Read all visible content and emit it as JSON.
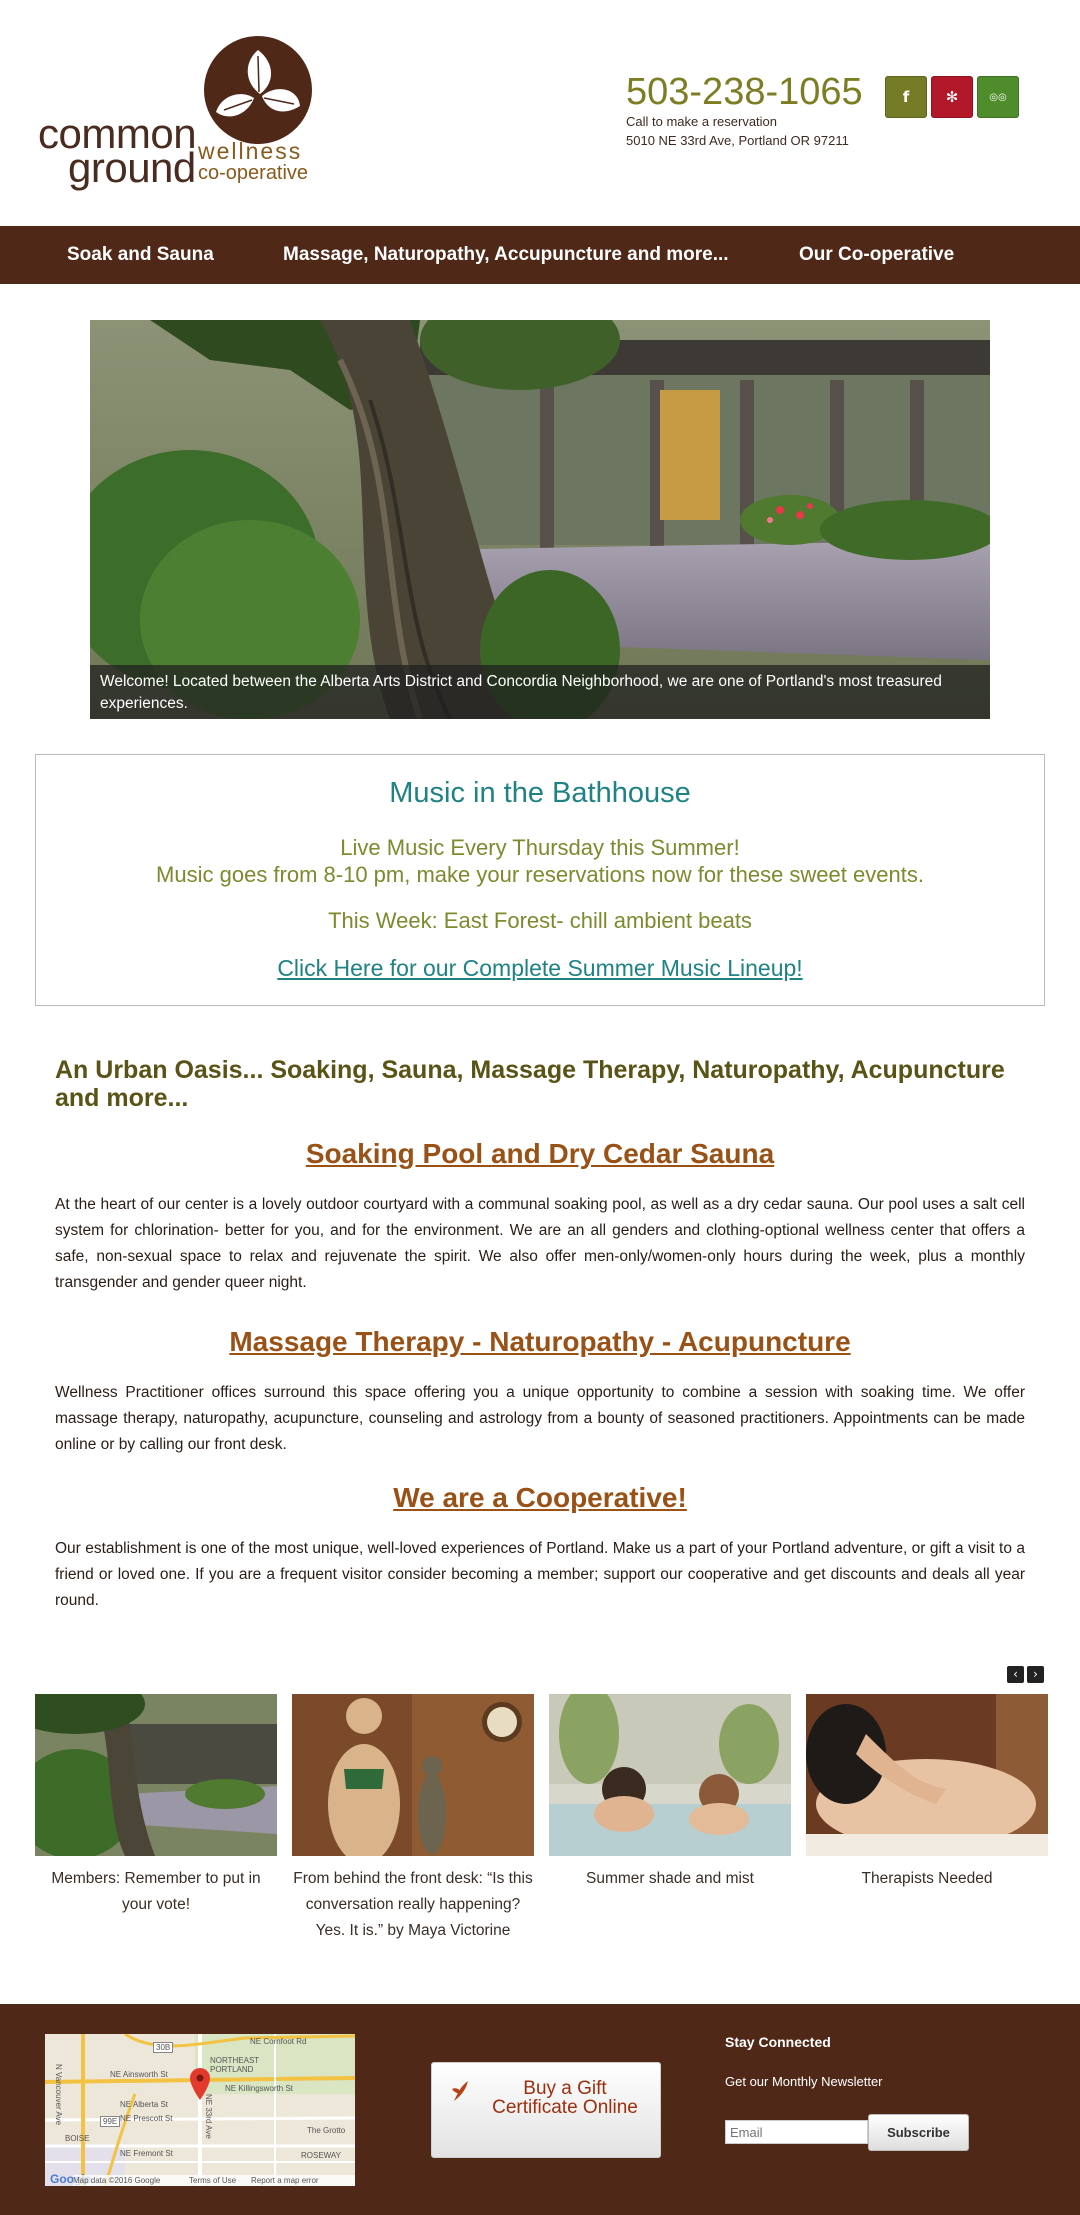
{
  "brand": {
    "logo_common": "common",
    "logo_ground": "ground",
    "logo_wellness": "wellness",
    "logo_coop": "co-operative",
    "brown": "#4f2818",
    "olive": "#7d7e23",
    "teal": "#1f8284",
    "rust": "#9a5116"
  },
  "header": {
    "phone": "503-238-1065",
    "reserve_text": "Call to make a reservation",
    "address": "5010 NE 33rd Ave, Portland OR 97211",
    "social": [
      {
        "icon": "facebook-icon",
        "glyph": "f"
      },
      {
        "icon": "yelp-icon",
        "glyph": "✻"
      },
      {
        "icon": "tripadvisor-icon",
        "glyph": "◎◎"
      }
    ]
  },
  "nav": {
    "items": [
      {
        "label": "Soak and Sauna"
      },
      {
        "label": "Massage, Naturopathy, Accupuncture and more..."
      },
      {
        "label": "Our Co-operative"
      }
    ]
  },
  "hero": {
    "caption": "Welcome! Located between the Alberta Arts District and Concordia Neighborhood, we are one of Portland's most treasured experiences."
  },
  "music": {
    "title": "Music in the Bathhouse",
    "line1": "Live Music Every Thursday this Summer!",
    "line2": "Music goes from 8-10 pm, make your reservations now for these sweet events.",
    "this_week": "This Week: East Forest- chill ambient beats",
    "link": "Click Here for our Complete Summer Music Lineup!"
  },
  "content": {
    "tagline": "An Urban Oasis... Soaking, Sauna, Massage Therapy, Naturopathy, Acupuncture and more...",
    "sections": [
      {
        "title": "Soaking Pool and Dry Cedar Sauna",
        "text": "At the heart of our center is a lovely outdoor courtyard with a communal soaking pool, as well as a dry cedar sauna.  Our pool uses a salt cell system for chlorination- better for you, and for the environment.  We are an all genders and clothing-optional wellness center that offers a safe, non-sexual space to relax and rejuvenate the spirit. We also offer men-only/women-only hours during the week, plus a monthly transgender and gender queer night."
      },
      {
        "title": "Massage Therapy - Naturopathy - Acupuncture ",
        "text": "Wellness Practitioner offices surround this space offering you a unique opportunity to combine a session with soaking time. We offer massage therapy, naturopathy, acupuncture, counseling and astrology from a bounty of seasoned practitioners.  Appointments can be made online or by calling our front desk."
      },
      {
        "title": "We are a Cooperative!",
        "text": "Our establishment is one of the most unique, well-loved experiences of Portland.  Make us a part of your Portland adventure, or gift a visit to a friend or loved one.  If you are a frequent visitor consider becoming a member; support our cooperative and get discounts and deals all year round."
      }
    ]
  },
  "carousel": {
    "prev_glyph": "‹",
    "next_glyph": "›",
    "slides": [
      {
        "caption": "Members: Remember to put in your vote!"
      },
      {
        "caption": "From behind the front desk: “Is this conversation really happening? Yes. It is.” by Maya Victorine"
      },
      {
        "caption": "Summer shade and mist"
      },
      {
        "caption": "Therapists Needed"
      }
    ]
  },
  "footer": {
    "map_labels": {
      "cornfoot": "NE Cornfoot Rd",
      "ainsworth": "NE Ainsworth St",
      "northeast": "NORTHEAST",
      "portland": "PORTLAND",
      "killingsworth": "NE Killingsworth St",
      "alberta": "NE Alberta St",
      "prescott": "NE Prescott St",
      "fremont": "NE Fremont St",
      "grotto": "The Grotto",
      "roseway": "ROSEWAY",
      "boise": "BOISE",
      "vancouver": "N Vancouver Ave",
      "thirty_third": "NE 33rd Ave",
      "hwy30": "30B",
      "hwy99": "99E",
      "google": "Google",
      "attribution": "Map data ©2016 Google",
      "terms": "Terms of Use",
      "report": "Report a map error"
    },
    "gift_label": "Buy a Gift Certificate Online",
    "stay_connected": "Stay Connected",
    "newsletter": "Get our Monthly Newsletter",
    "email_placeholder": "Email",
    "subscribe": "Subscribe"
  }
}
